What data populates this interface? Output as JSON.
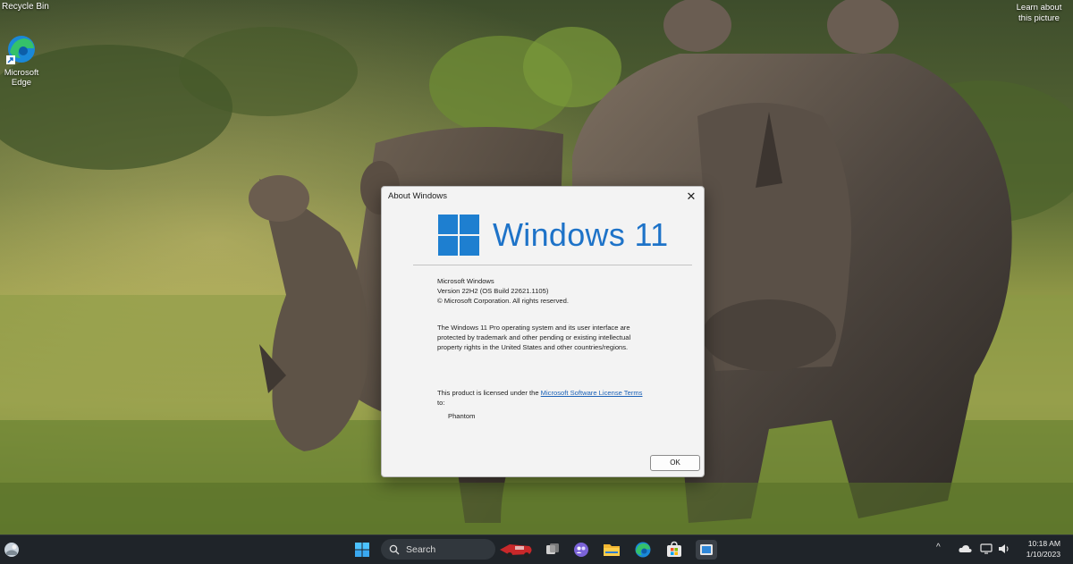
{
  "desktop": {
    "recycle_bin_label": "Recycle Bin",
    "edge_label": "Microsoft Edge",
    "learn_label": "Learn about this picture"
  },
  "dialog": {
    "title": "About Windows",
    "brand_text": "Windows 11",
    "product_name": "Microsoft Windows",
    "version": "Version 22H2 (OS Build 22621.1105)",
    "copyright": "© Microsoft Corporation. All rights reserved.",
    "legal_text": "The Windows 11 Pro operating system and its user interface are protected by trademark and other pending or existing intellectual property rights in the United States and other countries/regions.",
    "license_prefix": "This product is licensed under the ",
    "license_link": "Microsoft Software License Terms",
    "license_suffix": " to:",
    "licensee": "Phantom",
    "ok_label": "OK",
    "brand_color": "#1e73c8"
  },
  "taskbar": {
    "search_placeholder": "Search",
    "clock_time": "10:18 AM",
    "clock_date": "1/10/2023",
    "icons": [
      "widgets-icon",
      "start-icon",
      "search-icon",
      "game-widget-icon",
      "task-view-icon",
      "chat-icon",
      "file-explorer-icon",
      "edge-icon",
      "store-icon",
      "media-icon",
      "chevron-up-icon",
      "cloud-icon",
      "display-icon",
      "volume-icon"
    ]
  }
}
